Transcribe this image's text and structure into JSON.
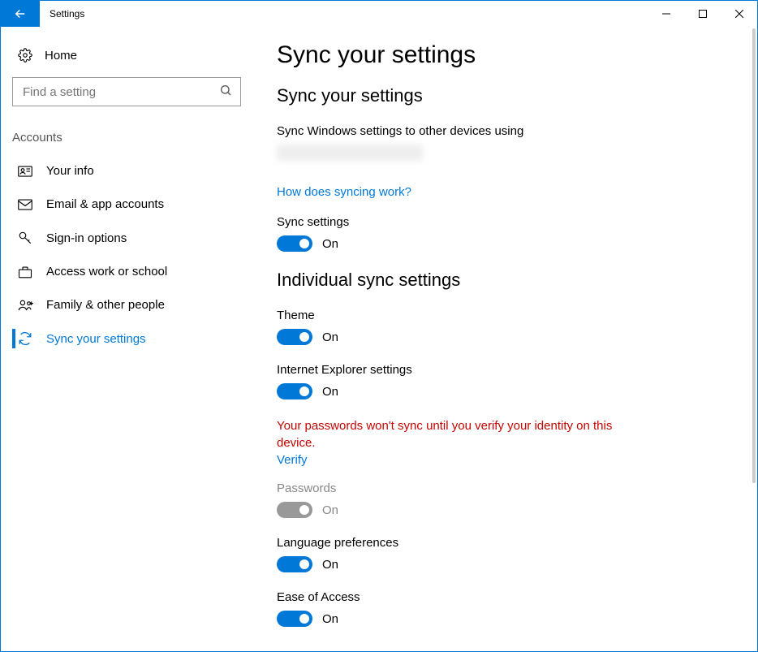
{
  "window": {
    "title": "Settings"
  },
  "sidebar": {
    "home": "Home",
    "search_placeholder": "Find a setting",
    "section": "Accounts",
    "items": [
      {
        "label": "Your info"
      },
      {
        "label": "Email & app accounts"
      },
      {
        "label": "Sign-in options"
      },
      {
        "label": "Access work or school"
      },
      {
        "label": "Family & other people"
      },
      {
        "label": "Sync your settings"
      }
    ]
  },
  "main": {
    "page_title": "Sync your settings",
    "section1": {
      "heading": "Sync your settings",
      "description": "Sync Windows settings to other devices using",
      "help_link": "How does syncing work?",
      "master_toggle": {
        "label": "Sync settings",
        "state": "On",
        "on": true
      }
    },
    "section2": {
      "heading": "Individual sync settings",
      "items": [
        {
          "label": "Theme",
          "state": "On",
          "on": true,
          "disabled": false
        },
        {
          "label": "Internet Explorer settings",
          "state": "On",
          "on": true,
          "disabled": false
        }
      ],
      "warning": "Your passwords won't sync until you verify your identity on this device.",
      "verify_link": "Verify",
      "items_after": [
        {
          "label": "Passwords",
          "state": "On",
          "on": true,
          "disabled": true
        },
        {
          "label": "Language preferences",
          "state": "On",
          "on": true,
          "disabled": false
        },
        {
          "label": "Ease of Access",
          "state": "On",
          "on": true,
          "disabled": false
        }
      ]
    }
  }
}
